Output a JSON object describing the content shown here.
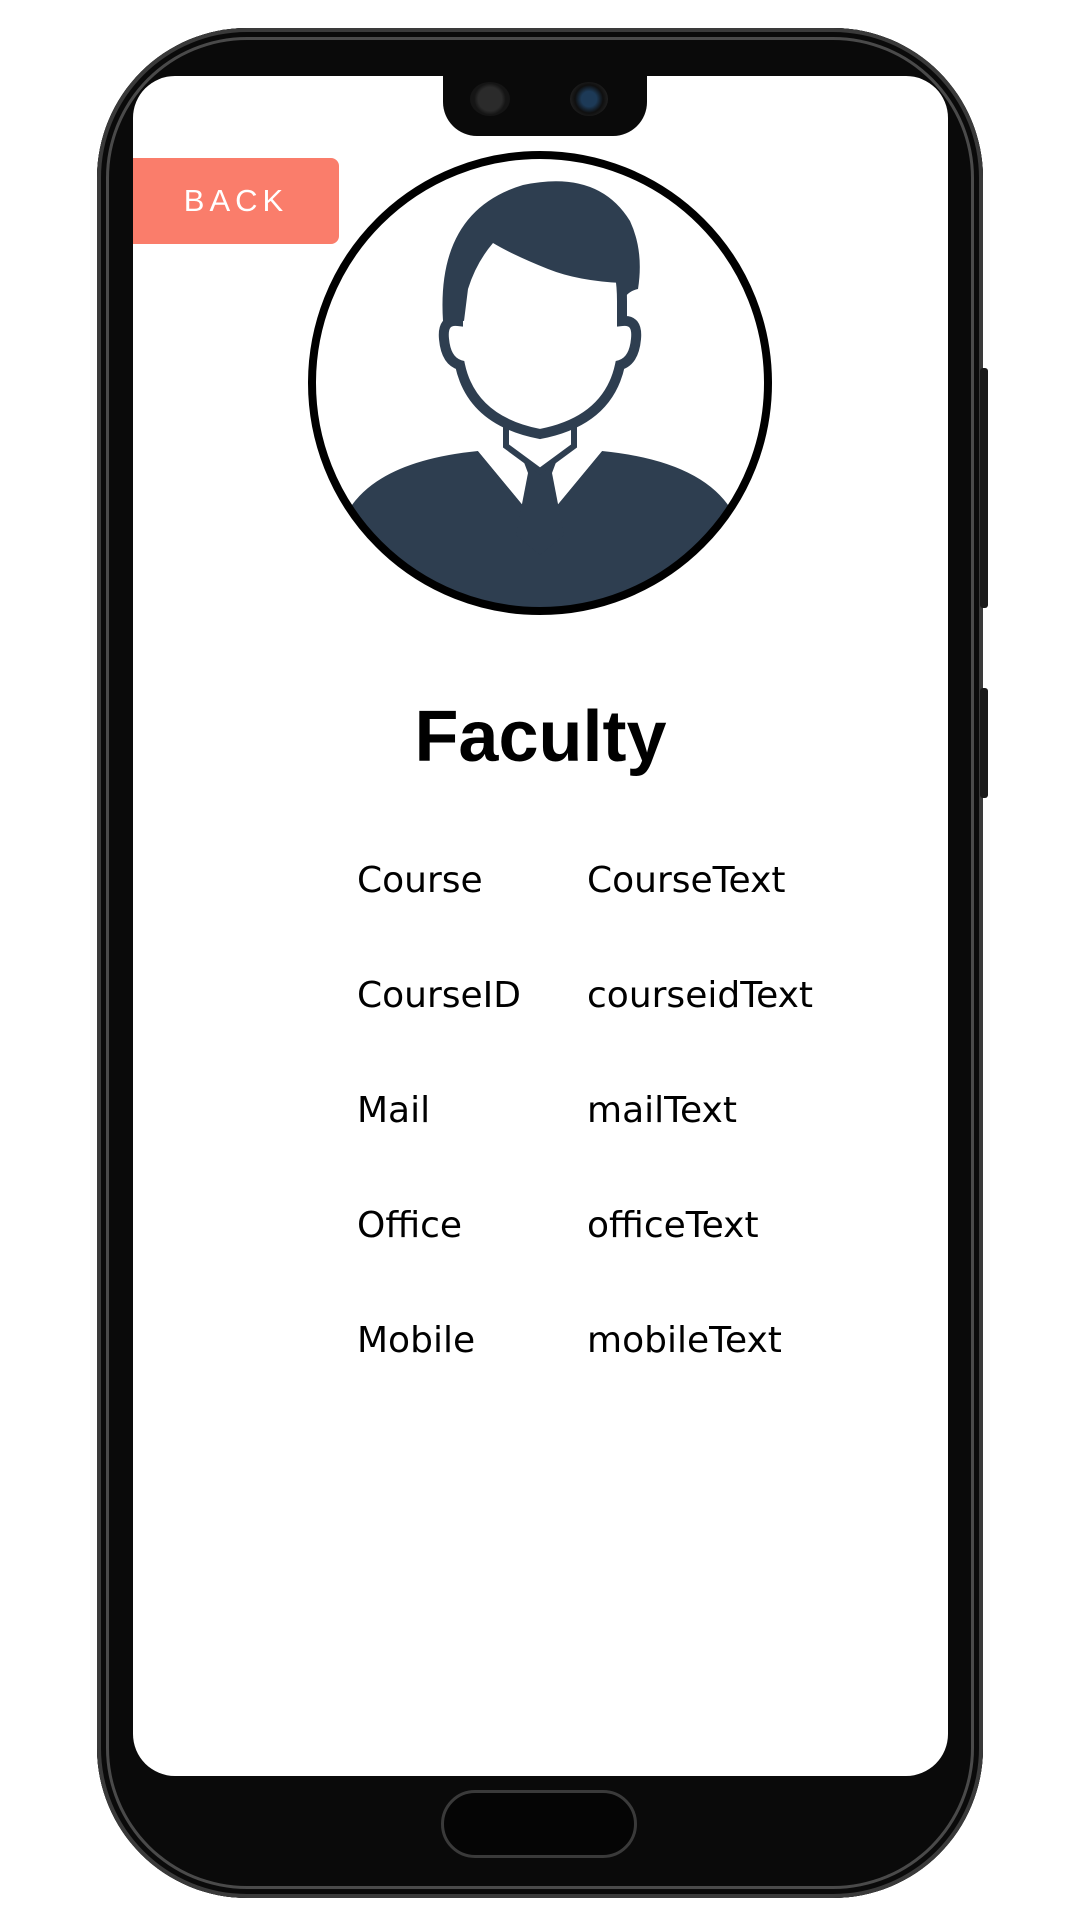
{
  "header": {
    "back_label": "BACK"
  },
  "profile": {
    "avatar_icon": "businessman-avatar-icon",
    "title": "Faculty"
  },
  "fields": [
    {
      "label": "Course",
      "value": "CourseText"
    },
    {
      "label": "CourseID",
      "value": "courseidText"
    },
    {
      "label": "Mail",
      "value": "mailText"
    },
    {
      "label": "Office",
      "value": "officeText"
    },
    {
      "label": "Mobile",
      "value": "mobileText"
    }
  ],
  "colors": {
    "accent": "#fa7d6b",
    "avatar": "#2e3e50"
  }
}
